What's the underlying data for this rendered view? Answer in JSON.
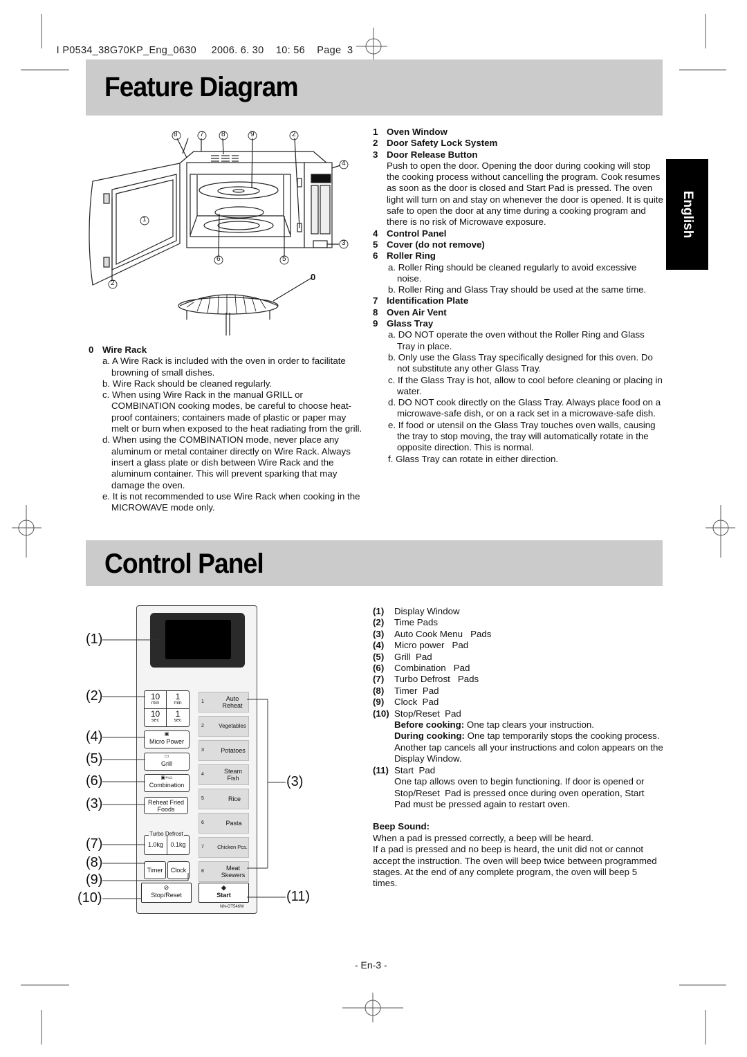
{
  "print_header": {
    "job": "I P0534_38G70KP_Eng_0630",
    "date": "2006. 6. 30",
    "time": "10: 56",
    "page": "Page  3"
  },
  "language_tab": "English",
  "feature_diagram": {
    "title": "Feature Diagram",
    "diagram_callouts": [
      "8",
      "7",
      "8",
      "9",
      "2",
      "4",
      "1",
      "3",
      "6",
      "5",
      "2",
      "0"
    ],
    "items": [
      {
        "num": "1",
        "label": "Oven Window"
      },
      {
        "num": "2",
        "label": "Door Safety Lock System"
      },
      {
        "num": "3",
        "label": "Door Release Button",
        "body": "Push to open the door. Opening the door during cooking will stop the cooking process without cancelling the program. Cook resumes as soon as the door is closed and Start Pad is pressed. The oven light will turn on and stay on whenever the door is opened. It is quite safe to open the door at any time during a cooking program and there is no risk of Microwave exposure."
      },
      {
        "num": "4",
        "label": "Control Panel"
      },
      {
        "num": "5",
        "label": "Cover (do not remove)"
      },
      {
        "num": "6",
        "label": "Roller Ring",
        "notes": [
          "a. Roller Ring should be cleaned regularly to avoid excessive noise.",
          "b. Roller Ring and Glass Tray should be used at the same time."
        ]
      },
      {
        "num": "7",
        "label": "Identification Plate"
      },
      {
        "num": "8",
        "label": "Oven Air Vent"
      },
      {
        "num": "9",
        "label": "Glass Tray",
        "notes": [
          "a. DO NOT operate the oven without the Roller Ring and Glass Tray in place.",
          "b. Only use the Glass Tray specifically designed for this oven. Do not substitute any other Glass Tray.",
          "c. If the Glass Tray is hot, allow to cool before cleaning or placing in water.",
          "d. DO NOT cook directly on the Glass Tray. Always place food on a microwave-safe dish, or on a rack set in a microwave-safe dish.",
          "e. If food or utensil on the Glass Tray touches oven walls, causing the tray to stop moving, the tray will automatically rotate in the opposite direction. This is normal.",
          "f. Glass Tray can rotate in either direction."
        ]
      }
    ],
    "wire_rack": {
      "num": "0",
      "label": "Wire Rack",
      "notes": [
        "a. A Wire Rack is included with the oven in order to facilitate browning of small dishes.",
        "b. Wire Rack should be cleaned regularly.",
        "c. When using Wire Rack in the manual GRILL or COMBINATION cooking modes, be careful to choose heat-proof containers; containers made of plastic or paper may melt or burn when exposed to the heat radiating from the grill.",
        "d. When using the COMBINATION mode, never place any aluminum or metal container directly on Wire Rack. Always insert a glass plate or dish between Wire Rack and the aluminum container. This will prevent sparking that may damage the oven.",
        "e. It is not recommended to use Wire Rack when cooking in the MICROWAVE mode only."
      ]
    }
  },
  "control_panel": {
    "title": "Control Panel",
    "callouts_left": [
      "(1)",
      "(2)",
      "(4)",
      "(5)",
      "(6)",
      "(3)",
      "(7)",
      "(8)",
      "(9)",
      "(10)"
    ],
    "callouts_right": [
      "(3)",
      "(11)"
    ],
    "pads": {
      "time": [
        {
          "big": "10",
          "small": "min"
        },
        {
          "big": "1",
          "small": "min"
        },
        {
          "big": "10",
          "small": "sec"
        },
        {
          "big": "1",
          "small": "sec"
        }
      ],
      "micro_power": "Micro Power",
      "grill": "Grill",
      "combination": "Combination",
      "reheat_fried": "Reheat Fried Foods",
      "turbo_defrost_label": "Turbo Defrost",
      "defrost_1kg": "1.0kg",
      "defrost_01kg": "0.1kg",
      "timer": "Timer",
      "clock": "Clock",
      "stop_reset": "Stop/Reset",
      "start": "Start",
      "model": "NN-GT546W",
      "auto_menu": [
        {
          "num": "1",
          "label": "Auto Reheat"
        },
        {
          "num": "2",
          "label": "Vegetables"
        },
        {
          "num": "3",
          "label": "Potatoes"
        },
        {
          "num": "4",
          "label": "Steam Fish"
        },
        {
          "num": "5",
          "label": "Rice"
        },
        {
          "num": "6",
          "label": "Pasta"
        },
        {
          "num": "7",
          "label": "Chicken Pcs."
        },
        {
          "num": "8",
          "label": "Meat Skewers"
        }
      ]
    },
    "legend": [
      {
        "num": "(1)",
        "label": "Display Window"
      },
      {
        "num": "(2)",
        "label": "Time  Pads"
      },
      {
        "num": "(3)",
        "label": "Auto Cook Menu   Pads"
      },
      {
        "num": "(4)",
        "label": "Micro power   Pad"
      },
      {
        "num": "(5)",
        "label": "Grill  Pad"
      },
      {
        "num": "(6)",
        "label": "Combination   Pad"
      },
      {
        "num": "(7)",
        "label": "Turbo Defrost   Pads"
      },
      {
        "num": "(8)",
        "label": "Timer  Pad"
      },
      {
        "num": "(9)",
        "label": "Clock  Pad"
      },
      {
        "num": "(10)",
        "label": "Stop/Reset  Pad"
      }
    ],
    "stop_reset_detail": {
      "before_label": "Before cooking:",
      "before_text": " One tap clears your instruction.",
      "during_label": "During cooking:",
      "during_text": " One tap temporarily stops the cooking process.  Another tap cancels all your instructions and colon appears on the Display Window."
    },
    "start_item": {
      "num": "(11)",
      "label": "Start  Pad",
      "body": "One tap allows oven to begin functioning. If door is opened or Stop/Reset  Pad is pressed once during oven operation, Start  Pad must be pressed again to restart oven."
    },
    "beep": {
      "title": "Beep Sound:",
      "line1": "When a pad is pressed correctly, a beep will be heard.",
      "line2": "If a pad is pressed and no beep is heard, the unit did not or cannot accept the instruction. The oven will beep twice between programmed stages. At the end of any complete program, the oven will beep 5 times."
    }
  },
  "page_number": "- En-3 -"
}
